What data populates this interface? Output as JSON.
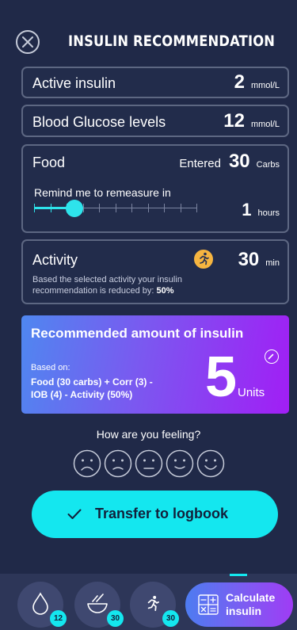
{
  "header": {
    "title": "INSULIN RECOMMENDATION",
    "close_icon": "close-icon"
  },
  "active_insulin": {
    "label": "Active insulin",
    "value": "2",
    "unit": "mmol/L"
  },
  "blood_glucose": {
    "label": "Blood Glucose levels",
    "value": "12",
    "unit": "mmol/L"
  },
  "food": {
    "label": "Food",
    "entered_label": "Entered",
    "value": "30",
    "unit": "Carbs",
    "remind_label": "Remind me to remeasure in",
    "remind_value": "1",
    "remind_unit": "hours",
    "slider_level": 0.25
  },
  "activity": {
    "label": "Activity",
    "icon": "running-icon",
    "value": "30",
    "unit": "min",
    "description": "Based the selected activity your insulin recommendation is reduced by:",
    "reduction": "50%"
  },
  "recommendation": {
    "title": "Recommended amount of insulin",
    "based_on_label": "Based on:",
    "formula_line1": "Food (30 carbs) + Corr (3) -",
    "formula_line2": "IOB (4) - Activity (50%)",
    "value": "5",
    "unit": "Units",
    "edit_icon": "pencil-icon"
  },
  "feeling": {
    "question": "How are you feeling?",
    "faces": [
      "very-sad-face-icon",
      "sad-face-icon",
      "neutral-face-icon",
      "happy-face-icon",
      "very-happy-face-icon"
    ]
  },
  "transfer": {
    "label": "Transfer to logbook",
    "icon": "checkmark-icon"
  },
  "nav": {
    "items": [
      {
        "icon": "drop-icon",
        "badge": "12"
      },
      {
        "icon": "food-bowl-icon",
        "badge": "30"
      },
      {
        "icon": "running-icon",
        "badge": "30"
      }
    ],
    "calculate_line1": "Calculate",
    "calculate_line2": "insulin",
    "calculate_icon": "calculator-icon"
  },
  "colors": {
    "background": "#202948",
    "accent": "#14e7ef",
    "activity_icon": "#f6b540"
  }
}
